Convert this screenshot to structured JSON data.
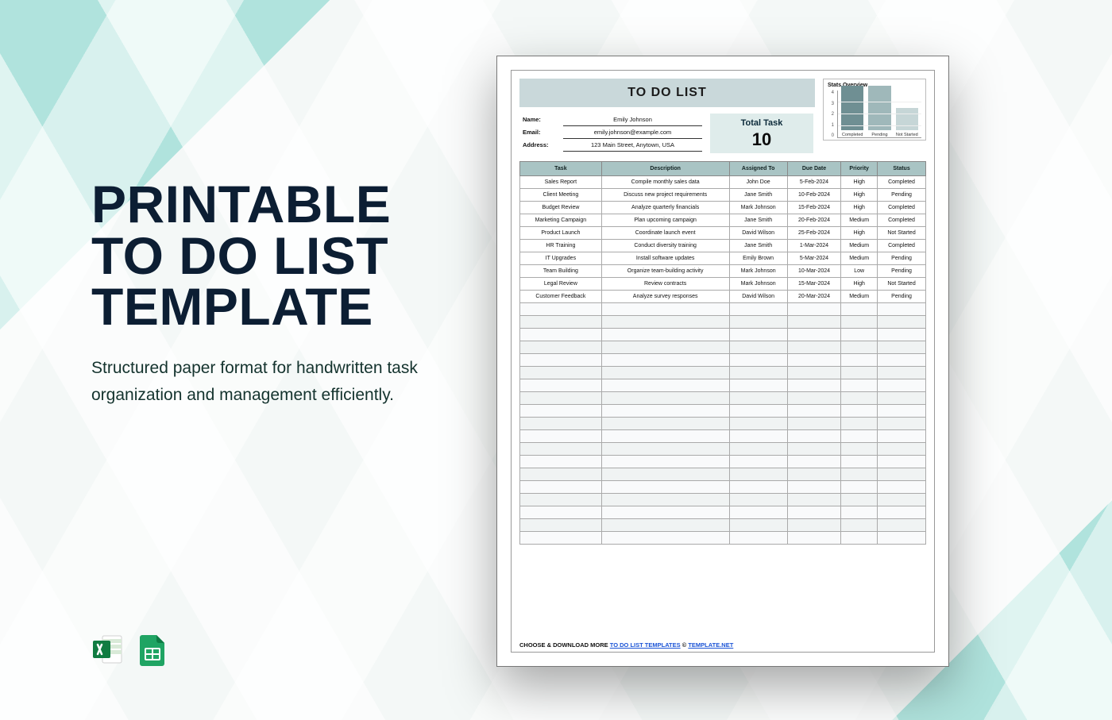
{
  "left": {
    "title_l1": "PRINTABLE",
    "title_l2": "TO DO LIST",
    "title_l3": "TEMPLATE",
    "description": "Structured paper format for handwritten task organization and management efficiently."
  },
  "icons": {
    "excel": "excel-file-icon",
    "sheets": "google-sheets-icon"
  },
  "doc": {
    "title": "TO DO LIST",
    "info": {
      "name_label": "Name:",
      "name_value": "Emily Johnson",
      "email_label": "Email:",
      "email_value": "emily.johnson@example.com",
      "address_label": "Address:",
      "address_value": "123 Main Street, Anytown, USA"
    },
    "total_task": {
      "label": "Total Task",
      "value": "10"
    },
    "stats": {
      "title": "Stats Overview"
    },
    "columns": [
      "Task",
      "Description",
      "Assigned To",
      "Due Date",
      "Priority",
      "Status"
    ],
    "rows": [
      {
        "task": "Sales Report",
        "desc": "Compile monthly sales data",
        "assigned": "John Doe",
        "due": "5-Feb-2024",
        "priority": "High",
        "status": "Completed"
      },
      {
        "task": "Client Meeting",
        "desc": "Discuss new project requirements",
        "assigned": "Jane Smith",
        "due": "10-Feb-2024",
        "priority": "High",
        "status": "Pending"
      },
      {
        "task": "Budget Review",
        "desc": "Analyze quarterly financials",
        "assigned": "Mark Johnson",
        "due": "15-Feb-2024",
        "priority": "High",
        "status": "Completed"
      },
      {
        "task": "Marketing Campaign",
        "desc": "Plan upcoming campaign",
        "assigned": "Jane Smith",
        "due": "20-Feb-2024",
        "priority": "Medium",
        "status": "Completed"
      },
      {
        "task": "Product Launch",
        "desc": "Coordinate launch event",
        "assigned": "David Wilson",
        "due": "25-Feb-2024",
        "priority": "High",
        "status": "Not Started"
      },
      {
        "task": "HR Training",
        "desc": "Conduct diversity training",
        "assigned": "Jane Smith",
        "due": "1-Mar-2024",
        "priority": "Medium",
        "status": "Completed"
      },
      {
        "task": "IT Upgrades",
        "desc": "Install software updates",
        "assigned": "Emily Brown",
        "due": "5-Mar-2024",
        "priority": "Medium",
        "status": "Pending"
      },
      {
        "task": "Team Building",
        "desc": "Organize team-building activity",
        "assigned": "Mark Johnson",
        "due": "10-Mar-2024",
        "priority": "Low",
        "status": "Pending"
      },
      {
        "task": "Legal Review",
        "desc": "Review contracts",
        "assigned": "Mark Johnson",
        "due": "15-Mar-2024",
        "priority": "High",
        "status": "Not Started"
      },
      {
        "task": "Customer Feedback",
        "desc": "Analyze survey responses",
        "assigned": "David Wilson",
        "due": "20-Mar-2024",
        "priority": "Medium",
        "status": "Pending"
      }
    ],
    "empty_rows": 19,
    "footer": {
      "pre": "CHOOSE & DOWNLOAD MORE ",
      "link1": "TO DO LIST TEMPLATES",
      "mid": " © ",
      "link2": "TEMPLATE.NET"
    }
  },
  "chart_data": {
    "type": "bar",
    "title": "Stats Overview",
    "categories": [
      "Completed",
      "Pending",
      "Not Started"
    ],
    "values": [
      4,
      4,
      2
    ],
    "colors": [
      "#6f8f93",
      "#9fb8ba",
      "#c6d6d7"
    ],
    "xlabel": "",
    "ylabel": "",
    "ylim": [
      0,
      4
    ],
    "ticks": [
      0,
      1,
      2,
      3,
      4
    ]
  }
}
